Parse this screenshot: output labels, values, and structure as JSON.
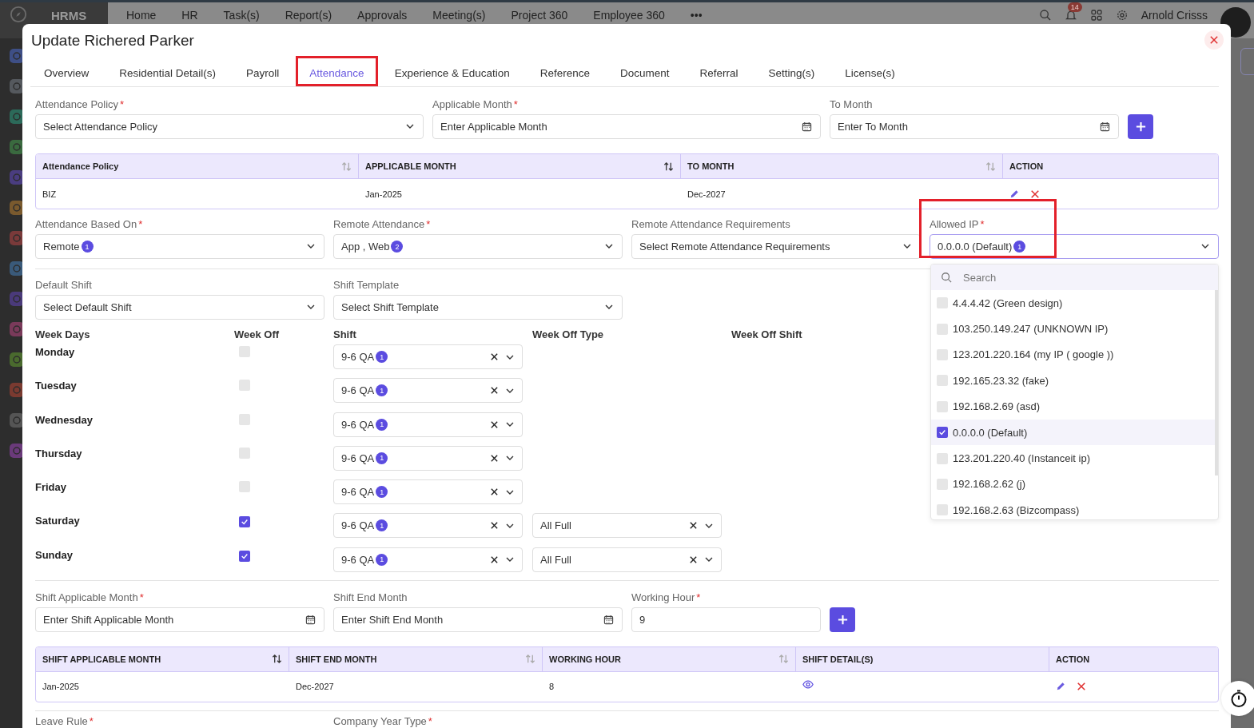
{
  "app": {
    "brand": "HRMS",
    "nav": [
      "Home",
      "HR",
      "Task(s)",
      "Report(s)",
      "Approvals",
      "Meeting(s)",
      "Project 360",
      "Employee 360"
    ],
    "more": "•••",
    "notification_count": "14",
    "user": "Arnold Crisss",
    "sidebar_icons": [
      {
        "color": "#3e4f86"
      },
      {
        "color": "#55595e"
      },
      {
        "color": "#2c6a5a"
      },
      {
        "color": "#3a6a3f"
      },
      {
        "color": "#4a3d80"
      },
      {
        "color": "#7a5a2e"
      },
      {
        "color": "#7a3a3a"
      },
      {
        "color": "#3a5a7a"
      },
      {
        "color": "#4a3a7a"
      },
      {
        "color": "#7a3a5a"
      },
      {
        "color": "#4a6a2e"
      },
      {
        "color": "#7a3a30"
      },
      {
        "color": "#555555"
      },
      {
        "color": "#6a3a7a"
      }
    ]
  },
  "modal": {
    "title": "Update Richered Parker"
  },
  "tabs": [
    {
      "label": "Overview",
      "selected": false,
      "highlighted": false
    },
    {
      "label": "Residential Detail(s)",
      "selected": false,
      "highlighted": false
    },
    {
      "label": "Payroll",
      "selected": false,
      "highlighted": false
    },
    {
      "label": "Attendance",
      "selected": true,
      "highlighted": true
    },
    {
      "label": "Experience & Education",
      "selected": false,
      "highlighted": false
    },
    {
      "label": "Reference",
      "selected": false,
      "highlighted": false
    },
    {
      "label": "Document",
      "selected": false,
      "highlighted": false
    },
    {
      "label": "Referral",
      "selected": false,
      "highlighted": false
    },
    {
      "label": "Setting(s)",
      "selected": false,
      "highlighted": false
    },
    {
      "label": "License(s)",
      "selected": false,
      "highlighted": false
    }
  ],
  "policy_fields": [
    {
      "label": "Attendance Policy",
      "required_mark": "*",
      "kind": "select",
      "placeholder": "Select Attendance Policy"
    },
    {
      "label": "Applicable Month",
      "required_mark": "*",
      "kind": "date",
      "placeholder": "Enter Applicable Month"
    },
    {
      "label": "To Month",
      "kind": "date",
      "placeholder": "Enter To Month"
    }
  ],
  "policy_table": {
    "columns": [
      {
        "label": "Attendance Policy",
        "kind": "text",
        "sorted": false
      },
      {
        "label": "APPLICABLE MONTH",
        "kind": "text",
        "sorted": true
      },
      {
        "label": "TO MONTH",
        "kind": "text",
        "sorted": false
      },
      {
        "label": "ACTION",
        "kind": "actions"
      }
    ],
    "rows": [
      {
        "cells": [
          "BIZ",
          "Jan-2025",
          "Dec-2027"
        ]
      }
    ]
  },
  "attendance_fields": [
    {
      "label": "Attendance Based On",
      "required_mark": "*",
      "kind": "select",
      "value": "Remote",
      "count": "1"
    },
    {
      "label": "Remote Attendance",
      "required_mark": "*",
      "kind": "select",
      "value": "App , Web",
      "count": "2"
    },
    {
      "label": "Remote Attendance Requirements",
      "kind": "select",
      "placeholder": "Select Remote Attendance Requirements"
    },
    {
      "label": "Allowed IP",
      "required_mark": "*",
      "kind": "select",
      "value": "0.0.0.0 (Default)",
      "count": "1",
      "highlighted": true,
      "open": true
    }
  ],
  "ip_dropdown": {
    "search_placeholder": "Search",
    "options": [
      {
        "label": "4.4.4.42 (Green design)",
        "checked": false
      },
      {
        "label": "103.250.149.247 (UNKNOWN IP)",
        "checked": false
      },
      {
        "label": "123.201.220.164 (my IP ( google ))",
        "checked": false
      },
      {
        "label": "192.165.23.32 (fake)",
        "checked": false
      },
      {
        "label": "192.168.2.69 (asd)",
        "checked": false
      },
      {
        "label": "0.0.0.0 (Default)",
        "checked": true
      },
      {
        "label": "123.201.220.40 (Instanceit ip)",
        "checked": false
      },
      {
        "label": "192.168.2.62 (j)",
        "checked": false
      },
      {
        "label": "192.168.2.63 (Bizcompass)",
        "checked": false
      }
    ]
  },
  "shift_fields": [
    {
      "label": "Default Shift",
      "kind": "select",
      "placeholder": "Select Default Shift"
    },
    {
      "label": "Shift Template",
      "kind": "select",
      "placeholder": "Select Shift Template"
    }
  ],
  "week_table": {
    "columns": [
      "Week Days",
      "Week Off",
      "Shift",
      "Week Off Type",
      "Week Off Shift"
    ],
    "rows": [
      {
        "day": "Monday",
        "week_off": false,
        "shift": "9-6 QA",
        "shift_count": "1"
      },
      {
        "day": "Tuesday",
        "week_off": false,
        "shift": "9-6 QA",
        "shift_count": "1"
      },
      {
        "day": "Wednesday",
        "week_off": false,
        "shift": "9-6 QA",
        "shift_count": "1"
      },
      {
        "day": "Thursday",
        "week_off": false,
        "shift": "9-6 QA",
        "shift_count": "1"
      },
      {
        "day": "Friday",
        "week_off": false,
        "shift": "9-6 QA",
        "shift_count": "1"
      },
      {
        "day": "Saturday",
        "week_off": true,
        "shift": "9-6 QA",
        "shift_count": "1",
        "week_off_type": "All Full"
      },
      {
        "day": "Sunday",
        "week_off": true,
        "shift": "9-6 QA",
        "shift_count": "1",
        "week_off_type": "All Full"
      }
    ]
  },
  "hour_fields": [
    {
      "label": "Shift Applicable Month",
      "required_mark": "*",
      "kind": "date",
      "placeholder": "Enter Shift Applicable Month"
    },
    {
      "label": "Shift End Month",
      "kind": "date",
      "placeholder": "Enter Shift End Month"
    },
    {
      "label": "Working Hour",
      "required_mark": "*",
      "kind": "text",
      "value": "9"
    }
  ],
  "shift_table": {
    "columns": [
      {
        "label": "SHIFT APPLICABLE MONTH",
        "kind": "text",
        "sorted": true
      },
      {
        "label": "SHIFT END MONTH",
        "kind": "text",
        "sorted": false
      },
      {
        "label": "WORKING HOUR",
        "kind": "text",
        "sorted": false
      },
      {
        "label": "SHIFT DETAIL(S)",
        "kind": "details"
      },
      {
        "label": "ACTION",
        "kind": "actions"
      }
    ],
    "rows": [
      {
        "cells": [
          "Jan-2025",
          "Dec-2027",
          "8"
        ]
      }
    ]
  },
  "next_fields": [
    {
      "label": "Leave Rule",
      "required_mark": "*"
    },
    {
      "label": "Company Year Type",
      "required_mark": "*"
    }
  ]
}
